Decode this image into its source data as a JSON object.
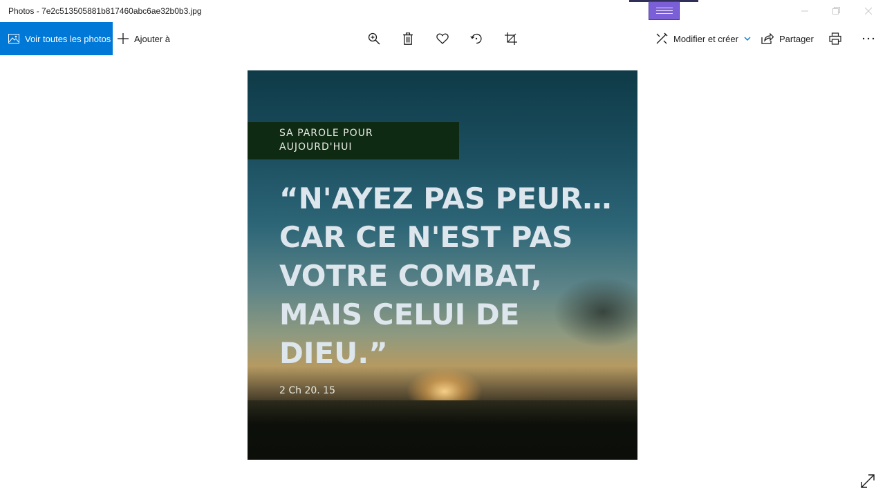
{
  "window": {
    "title": "Photos - 7e2c513505881b817460abc6ae32b0b3.jpg",
    "controls": [
      "minimize-icon",
      "restore-icon",
      "close-icon"
    ]
  },
  "toolbar": {
    "view_all_label": "Voir toutes les photos",
    "add_label": "Ajouter à",
    "tools": [
      "zoom-in-icon",
      "delete-icon",
      "favorite-icon",
      "rotate-icon",
      "crop-icon"
    ],
    "edit_label": "Modifier et créer",
    "share_label": "Partager",
    "print_icon": "print-icon",
    "more_icon": "more-icon"
  },
  "photo": {
    "banner_line1": "SA PAROLE POUR",
    "banner_line2": "AUJOURD'HUI",
    "quote": "“N'AYEZ PAS PEUR…\nCAR CE N'EST PAS\nVOTRE COMBAT,\nMAIS CELUI DE\nDIEU.”",
    "reference": "2 Ch 20. 15"
  },
  "colors": {
    "accent": "#0078d7",
    "banner": "#0f2a13",
    "quote_text": "#dde6ec"
  }
}
